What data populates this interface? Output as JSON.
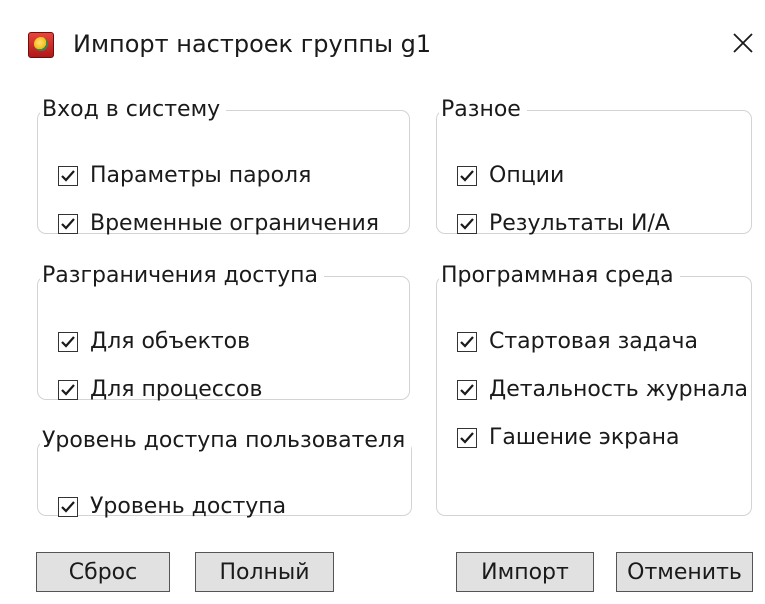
{
  "window": {
    "title": "Импорт настроек группы g1",
    "icon": "app-icon",
    "close_icon": "close-icon"
  },
  "groups": {
    "login": {
      "title": "Вход в систему",
      "items": [
        {
          "label": "Параметры пароля",
          "checked": true
        },
        {
          "label": "Временные ограничения",
          "checked": true
        }
      ]
    },
    "access": {
      "title": "Разграничения доступа",
      "items": [
        {
          "label": "Для объектов",
          "checked": true
        },
        {
          "label": "Для процессов",
          "checked": true
        }
      ]
    },
    "user_level": {
      "title": "Уровень доступа пользователя",
      "items": [
        {
          "label": "Уровень доступа",
          "checked": true
        }
      ]
    },
    "misc": {
      "title": "Разное",
      "items": [
        {
          "label": "Опции",
          "checked": true
        },
        {
          "label": "Результаты И/А",
          "checked": true
        }
      ]
    },
    "env": {
      "title": "Программная среда",
      "items": [
        {
          "label": "Стартовая задача",
          "checked": true
        },
        {
          "label": "Детальность журнала",
          "checked": true
        },
        {
          "label": "Гашение экрана",
          "checked": true
        }
      ]
    }
  },
  "buttons": {
    "reset": "Сброс",
    "full": "Полный",
    "import": "Импорт",
    "cancel": "Отменить"
  },
  "colors": {
    "button_face": "#e1e1e1",
    "group_border": "#d3d3d3",
    "check_mark": "#1a1a1a"
  }
}
